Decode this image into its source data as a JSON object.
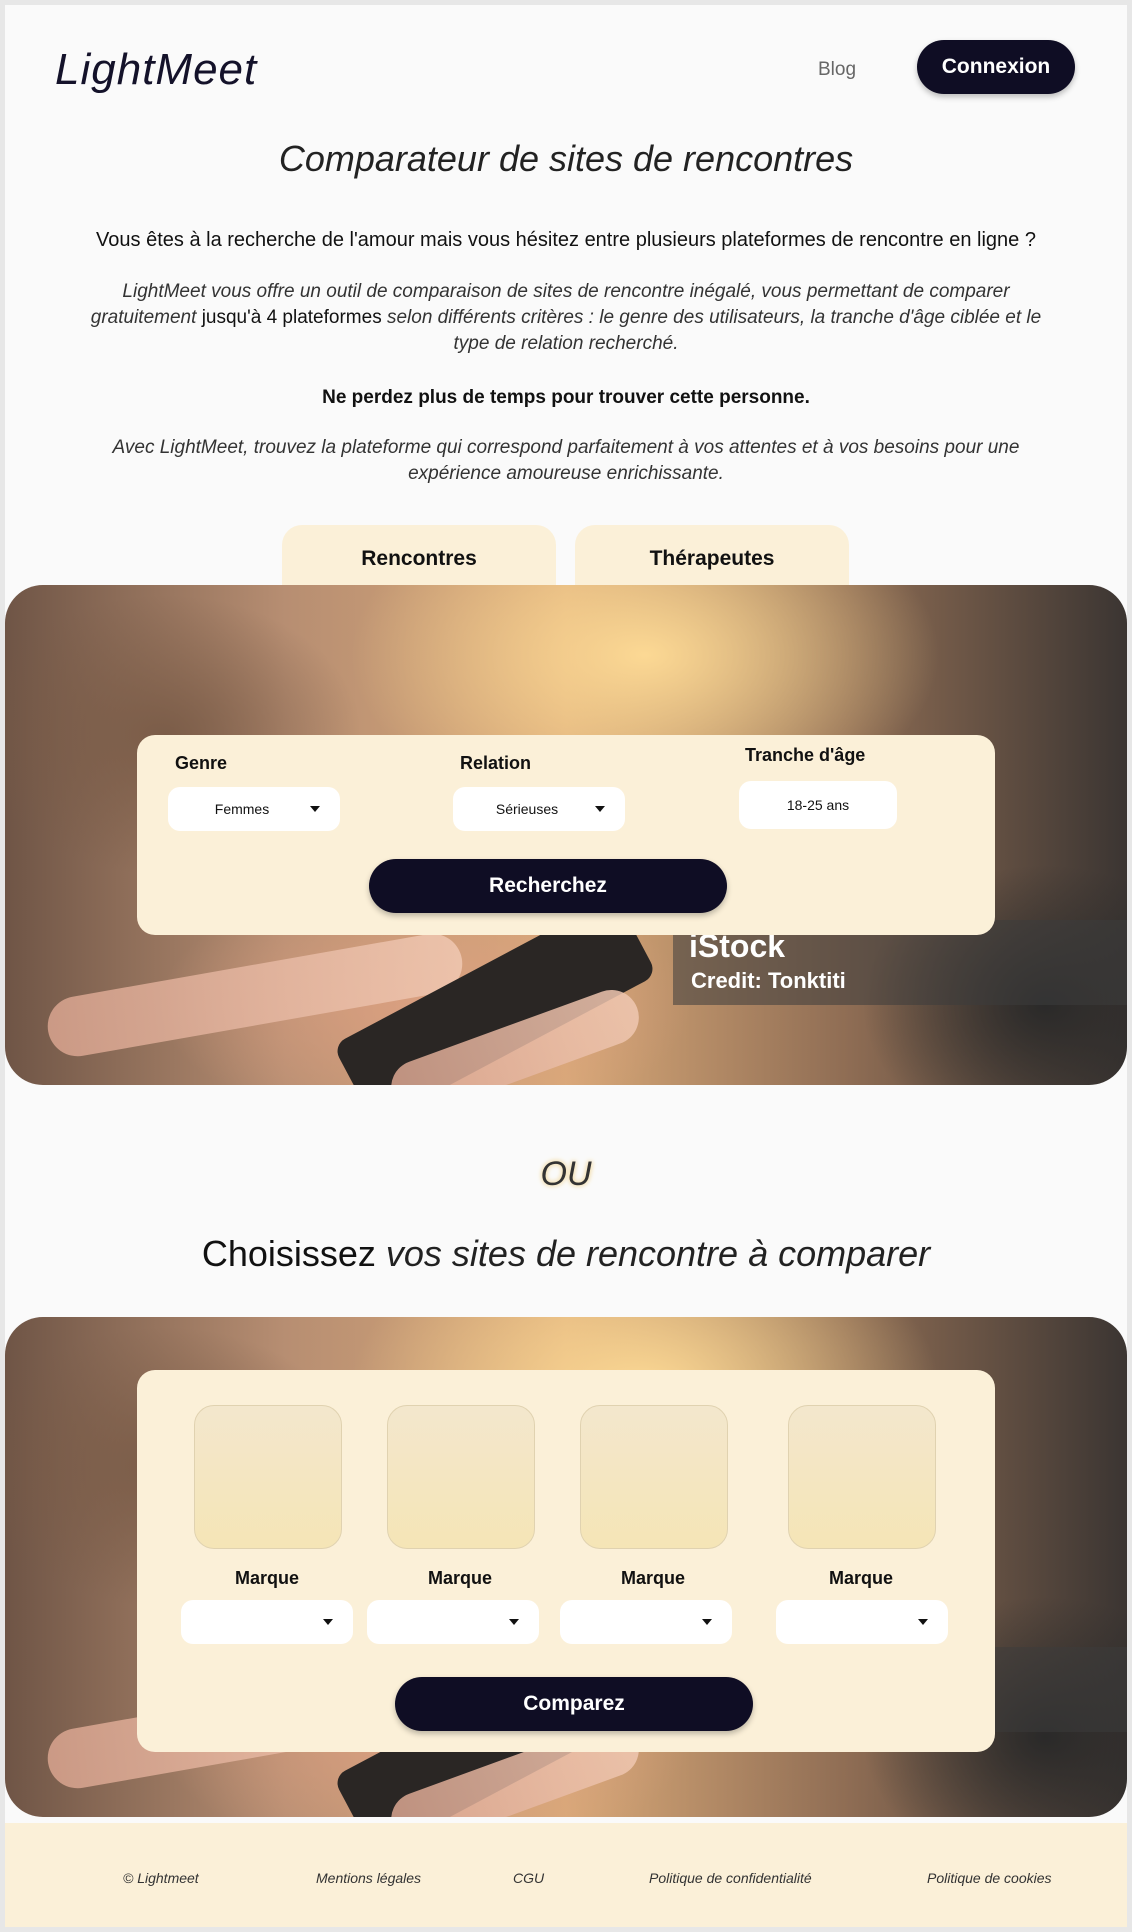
{
  "header": {
    "logo": "LightMeet",
    "nav_blog": "Blog",
    "login_label": "Connexion"
  },
  "page_title": "Comparateur de sites de rencontres",
  "intro": {
    "question": "Vous êtes à la recherche de l'amour mais vous hésitez entre plusieurs plateformes de rencontre en ligne ?",
    "p1_before": "LightMeet vous offre un outil de comparaison de sites de rencontre inégalé, vous permettant de comparer gratuitement ",
    "p1_emphasis": "jusqu'à 4 plateformes",
    "p1_after": " selon différents critères : le genre des utilisateurs, la tranche d'âge ciblée et le type de relation recherché.",
    "strong": "Ne perdez plus de temps pour trouver cette personne.",
    "p2": "Avec LightMeet, trouvez la plateforme qui correspond parfaitement à vos attentes et à vos besoins pour une expérience amoureuse enrichissante."
  },
  "tabs": [
    {
      "label": "Rencontres"
    },
    {
      "label": "Thérapeutes"
    }
  ],
  "hero": {
    "watermark_brand": "iStock",
    "watermark_credit": "Credit: Tonktiti"
  },
  "search": {
    "genre_label": "Genre",
    "genre_value": "Femmes",
    "relation_label": "Relation",
    "relation_value": "Sérieuses",
    "age_label": "Tranche d'âge",
    "age_value": "18-25 ans",
    "button_label": "Recherchez"
  },
  "separator": "OU",
  "compare_heading": {
    "bold": "Choisissez",
    "italic": " vos sites de rencontre à comparer"
  },
  "compare": {
    "brands": [
      {
        "label": "Marque",
        "value": ""
      },
      {
        "label": "Marque",
        "value": ""
      },
      {
        "label": "Marque",
        "value": ""
      },
      {
        "label": "Marque",
        "value": ""
      }
    ],
    "button_label": "Comparez"
  },
  "footer": {
    "copyright": "© Lightmeet",
    "links": [
      "Mentions légales",
      "CGU",
      "Politique de confidentialité",
      "Politique de cookies"
    ]
  }
}
